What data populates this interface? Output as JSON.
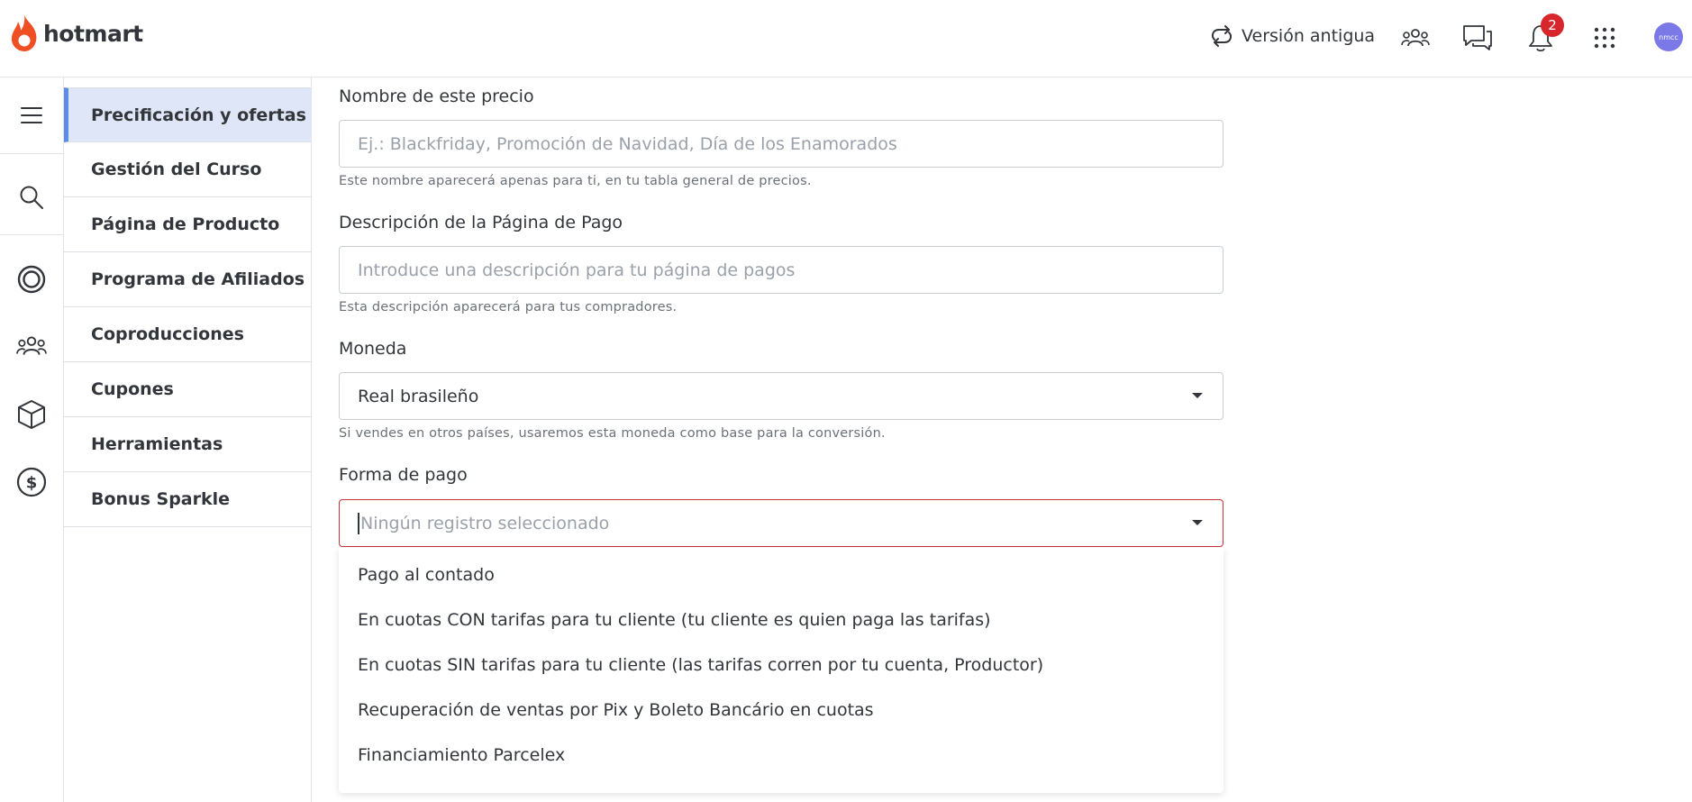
{
  "header": {
    "logo_text": "hotmart",
    "old_version_label": "Versión antigua",
    "notifications_count": "2",
    "avatar_text": "nmcc",
    "colors": {
      "brand_flame": "#f04e23",
      "badge": "#d7262c",
      "avatar": "#7b78e8"
    }
  },
  "rail": {
    "icons": [
      "menu-icon",
      "search-icon",
      "circle-icon",
      "users-icon",
      "box-icon",
      "dollar-icon"
    ]
  },
  "subnav": {
    "items": [
      {
        "label": "Precificación y ofertas",
        "active": true
      },
      {
        "label": "Gestión del Curso"
      },
      {
        "label": "Página de Producto"
      },
      {
        "label": "Programa de Afiliados"
      },
      {
        "label": "Coproducciones"
      },
      {
        "label": "Cupones"
      },
      {
        "label": "Herramientas"
      },
      {
        "label": "Bonus Sparkle"
      }
    ]
  },
  "form": {
    "name": {
      "label": "Nombre de este precio",
      "placeholder": "Ej.: Blackfriday, Promoción de Navidad, Día de los Enamorados",
      "help": "Este nombre aparecerá apenas para ti, en tu tabla general de precios."
    },
    "description": {
      "label": "Descripción de la Página de Pago",
      "placeholder": "Introduce una descripción para tu página de pagos",
      "help": "Esta descripción aparecerá para tus compradores."
    },
    "currency": {
      "label": "Moneda",
      "value": "Real brasileño",
      "help": "Si vendes en otros países, usaremos esta moneda como base para la conversión."
    },
    "payment": {
      "label": "Forma de pago",
      "placeholder": "Ningún registro seleccionado",
      "options": [
        "Pago al contado",
        "En cuotas CON tarifas para tu cliente (tu cliente es quien paga las tarifas)",
        "En cuotas SIN tarifas para tu cliente (las tarifas corren por tu cuenta, Productor)",
        "Recuperación de ventas por Pix y Boleto Bancário en cuotas",
        "Financiamiento Parcelex"
      ]
    }
  }
}
